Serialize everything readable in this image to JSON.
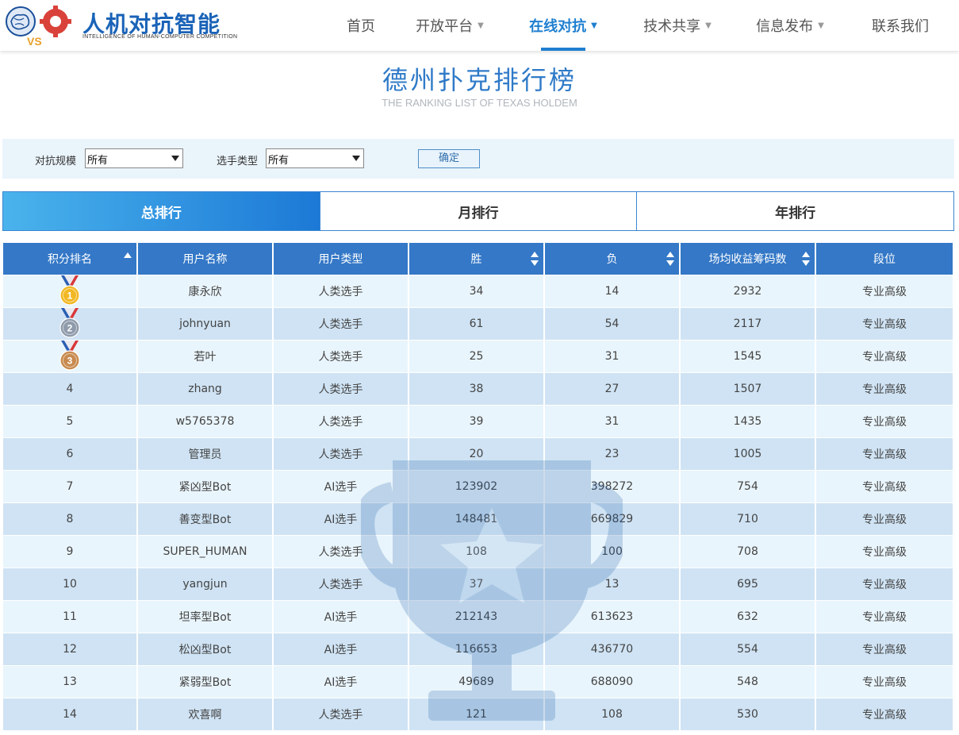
{
  "header": {
    "logo_badge": "VS",
    "logo_title": "人机对抗智能",
    "logo_subtitle": "INTELLIGENCE OF HUMAN-COMPUTER COMPETITION",
    "nav": [
      {
        "label": "首页",
        "caret": "",
        "active": false
      },
      {
        "label": "开放平台",
        "caret": "▼",
        "active": false
      },
      {
        "label": "在线对抗",
        "caret": "▼",
        "active": true
      },
      {
        "label": "技术共享",
        "caret": "▼",
        "active": false
      },
      {
        "label": "信息发布",
        "caret": "▼",
        "active": false
      },
      {
        "label": "联系我们",
        "caret": "",
        "active": false
      }
    ]
  },
  "title": {
    "main": "德州扑克排行榜",
    "sub": "THE RANKING LIST OF TEXAS HOLDEM"
  },
  "filters": {
    "scale_label": "对抗规模",
    "scale_value": "所有",
    "type_label": "选手类型",
    "type_value": "所有",
    "confirm_label": "确定"
  },
  "tabs": [
    {
      "label": "总排行",
      "active": true
    },
    {
      "label": "月排行",
      "active": false
    },
    {
      "label": "年排行",
      "active": false
    }
  ],
  "table": {
    "headers": [
      "积分排名",
      "用户名称",
      "用户类型",
      "胜",
      "负",
      "场均收益筹码数",
      "段位"
    ],
    "rows": [
      {
        "rank": "",
        "medal": "1",
        "name": "康永欣",
        "type": "人类选手",
        "win": "34",
        "loss": "14",
        "avg": "2932",
        "level": "专业高级"
      },
      {
        "rank": "",
        "medal": "2",
        "name": "johnyuan",
        "type": "人类选手",
        "win": "61",
        "loss": "54",
        "avg": "2117",
        "level": "专业高级"
      },
      {
        "rank": "",
        "medal": "3",
        "name": "若叶",
        "type": "人类选手",
        "win": "25",
        "loss": "31",
        "avg": "1545",
        "level": "专业高级"
      },
      {
        "rank": "4",
        "medal": "",
        "name": "zhang",
        "type": "人类选手",
        "win": "38",
        "loss": "27",
        "avg": "1507",
        "level": "专业高级"
      },
      {
        "rank": "5",
        "medal": "",
        "name": "w5765378",
        "type": "人类选手",
        "win": "39",
        "loss": "31",
        "avg": "1435",
        "level": "专业高级"
      },
      {
        "rank": "6",
        "medal": "",
        "name": "管理员",
        "type": "人类选手",
        "win": "20",
        "loss": "23",
        "avg": "1005",
        "level": "专业高级"
      },
      {
        "rank": "7",
        "medal": "",
        "name": "紧凶型Bot",
        "type": "AI选手",
        "win": "123902",
        "loss": "398272",
        "avg": "754",
        "level": "专业高级"
      },
      {
        "rank": "8",
        "medal": "",
        "name": "善变型Bot",
        "type": "AI选手",
        "win": "148481",
        "loss": "669829",
        "avg": "710",
        "level": "专业高级"
      },
      {
        "rank": "9",
        "medal": "",
        "name": "SUPER_HUMAN",
        "type": "人类选手",
        "win": "108",
        "loss": "100",
        "avg": "708",
        "level": "专业高级"
      },
      {
        "rank": "10",
        "medal": "",
        "name": "yangjun",
        "type": "人类选手",
        "win": "37",
        "loss": "13",
        "avg": "695",
        "level": "专业高级"
      },
      {
        "rank": "11",
        "medal": "",
        "name": "坦率型Bot",
        "type": "AI选手",
        "win": "212143",
        "loss": "613623",
        "avg": "632",
        "level": "专业高级"
      },
      {
        "rank": "12",
        "medal": "",
        "name": "松凶型Bot",
        "type": "AI选手",
        "win": "116653",
        "loss": "436770",
        "avg": "554",
        "level": "专业高级"
      },
      {
        "rank": "13",
        "medal": "",
        "name": "紧弱型Bot",
        "type": "AI选手",
        "win": "49689",
        "loss": "688090",
        "avg": "548",
        "level": "专业高级"
      },
      {
        "rank": "14",
        "medal": "",
        "name": "欢喜啊",
        "type": "人类选手",
        "win": "121",
        "loss": "108",
        "avg": "530",
        "level": "专业高级"
      }
    ]
  },
  "colors": {
    "brand": "#1a63b8",
    "accent": "#1f7fd0",
    "header_row": "#3478c7",
    "gold": "#f2b824",
    "silver": "#8f9bab",
    "bronze": "#c88a4f"
  }
}
